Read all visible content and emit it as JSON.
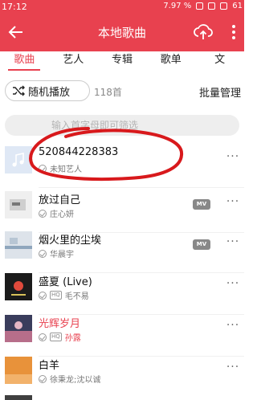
{
  "status": {
    "time": "17:12",
    "battery": "7.97 %",
    "level": "61"
  },
  "header": {
    "title": "本地歌曲"
  },
  "tabs": [
    "歌曲",
    "艺人",
    "专辑",
    "歌单",
    "文"
  ],
  "toolbar": {
    "shuffle_label": "随机播放",
    "count": "118首",
    "manage_label": "批量管理"
  },
  "search": {
    "placeholder": "输入首字母即可筛选"
  },
  "songs": [
    {
      "title": "520844228383",
      "artist": "未知艺人",
      "mv": "",
      "hq": "",
      "cover_color": "#dfe8f5"
    },
    {
      "title": "放过自己",
      "artist": "庄心妍",
      "mv": "MV",
      "hq": "",
      "cover_color": "#efefef"
    },
    {
      "title": "烟火里的尘埃",
      "artist": "华晨宇",
      "mv": "MV",
      "hq": "",
      "cover_color": "#dde3ea"
    },
    {
      "title": "盛夏 (Live)",
      "artist": "毛不易",
      "mv": "",
      "hq": "HQ",
      "cover_color": "#1b1b1b"
    },
    {
      "title": "光辉岁月",
      "artist": "孙露",
      "mv": "",
      "hq": "HQ",
      "cover_color": "#b76e8a"
    },
    {
      "title": "白羊",
      "artist": "徐秉龙;沈以诚",
      "mv": "",
      "hq": "",
      "cover_color": "#e8923a"
    }
  ],
  "colors": {
    "accent": "#e8414f",
    "annotation": "#d8191c"
  }
}
